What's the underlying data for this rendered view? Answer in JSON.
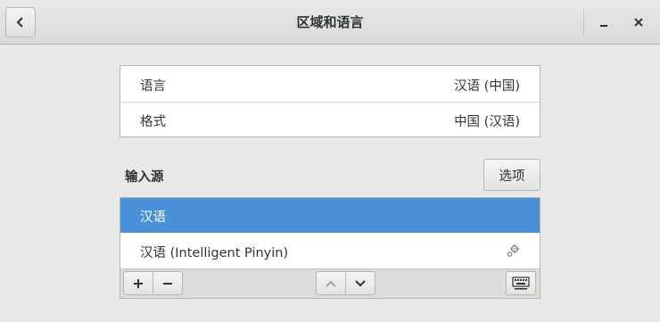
{
  "window": {
    "title": "区域和语言"
  },
  "language_section": {
    "rows": [
      {
        "label": "语言",
        "value": "汉语 (中国)"
      },
      {
        "label": "格式",
        "value": "中国 (汉语)"
      }
    ]
  },
  "input_sources": {
    "heading": "输入源",
    "options_label": "选项",
    "items": [
      {
        "label": "汉语",
        "selected": true
      },
      {
        "label": "汉语 (Intelligent Pinyin)",
        "has_settings": true,
        "settings_icon": "gears-icon"
      }
    ],
    "toolbar": {
      "add_label": "+",
      "remove_label": "−",
      "icons": [
        "chevron-up-icon",
        "chevron-down-icon",
        "keyboard-layout-icon"
      ]
    }
  },
  "colors": {
    "selection": "#4a90d9",
    "window_bg": "#e8e8e7",
    "text": "#2e3436"
  }
}
